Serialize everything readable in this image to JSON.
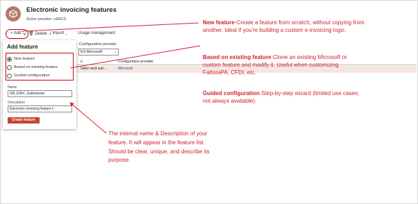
{
  "header": {
    "title": "Electronic invoicing features",
    "provider": "Active provider: eEBCS"
  },
  "toolbar": {
    "add_label": "+ Add",
    "delete_label": "Delete",
    "import_label": "Import",
    "usage_label": "Usage management"
  },
  "add_panel": {
    "title": "Add feature",
    "options": [
      {
        "label": "New feature",
        "selected": true
      },
      {
        "label": "Based on existing feature",
        "selected": false
      },
      {
        "label": "Guided configuration",
        "selected": false
      }
    ],
    "name_label": "Name",
    "name_value": "GB_EINV_Submission",
    "description_label": "Description",
    "description_value": "Electronic invoicing feature f...",
    "create_label": "Create feature"
  },
  "filter": {
    "label": "Configuration provider",
    "value": "ES:Microsoft"
  },
  "grid": {
    "columns": [
      "n",
      "Configuration provider"
    ],
    "rows": [
      {
        "col1": "ration and sub...",
        "col2": "Microsoft"
      }
    ]
  },
  "annotations": {
    "new_feature_title": "New feature",
    "new_feature_text": "-Create a feature from scratch, without copying from another. Ideal if you're building a custom e-invoicing logic.",
    "based_title": "Based on existing feature",
    "based_text": "-Clone an existing Microsoft or custom feature and modify it. Useful when customizing FatturaPA, CFDI, etc.",
    "guided_title": "Guided configuration",
    "guided_text": "-Step-by-step wizard (limited use cases; not always available).",
    "name_desc_note": "The internal name & Description of your feature. It will appear in the feature list. Should be clear, unique, and describe its purpose."
  },
  "colors": {
    "annotation": "#d1202a",
    "highlight_box": "#cf0000",
    "create_button": "#c5452f",
    "selected_row": "#f6e6e0"
  }
}
